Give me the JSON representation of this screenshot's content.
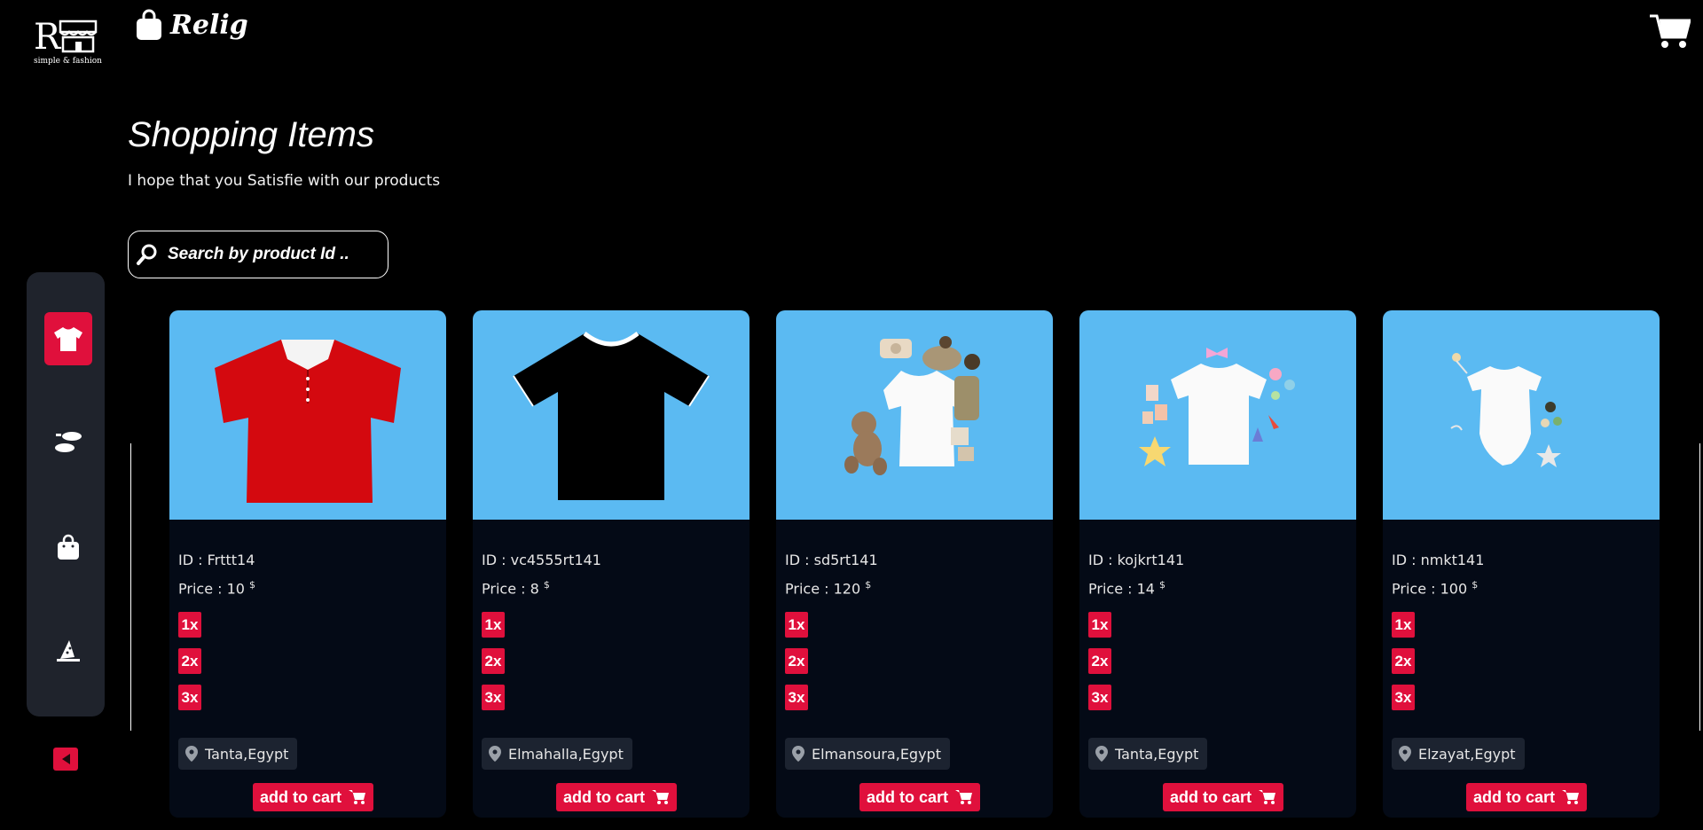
{
  "logo": {
    "mark": "R",
    "tagline": "simple & fashion"
  },
  "brand": {
    "name": "Relig",
    "icon": "shopping-bag-icon"
  },
  "header": {
    "cart_icon": "cart-icon"
  },
  "page": {
    "title": "Shopping Items",
    "subtitle": "I hope that you Satisfie with our products"
  },
  "search": {
    "placeholder": "Search by product Id ..",
    "icon": "search-icon"
  },
  "sidebar": {
    "items": [
      {
        "icon": "tshirt-icon",
        "active": true
      },
      {
        "icon": "shoes-icon",
        "active": false
      },
      {
        "icon": "bag-icon",
        "active": false
      },
      {
        "icon": "hat-icon",
        "active": false
      }
    ],
    "collapse_icon": "caret-left-icon"
  },
  "colors": {
    "accent": "#e0103c",
    "card_image_bg": "#5bbaf2",
    "card_bg": "#040a16",
    "sidebar_bg": "#1f232c"
  },
  "products": [
    {
      "id_text": "ID : Frttt14",
      "price_text": "Price : 10",
      "currency": "$",
      "image": "red-polo-shirt",
      "quantities": [
        "1x",
        "2x",
        "3x"
      ],
      "location": "Tanta,Egypt",
      "add_label": "add to cart"
    },
    {
      "id_text": "ID : vc4555rt141",
      "price_text": "Price : 8",
      "currency": "$",
      "image": "black-tshirt",
      "quantities": [
        "1x",
        "2x",
        "3x"
      ],
      "location": "Elmahalla,Egypt",
      "add_label": "add to cart"
    },
    {
      "id_text": "ID : sd5rt141",
      "price_text": "Price : 120",
      "currency": "$",
      "image": "baby-clothes-teddy-bear",
      "quantities": [
        "1x",
        "2x",
        "3x"
      ],
      "location": "Elmansoura,Egypt",
      "add_label": "add to cart"
    },
    {
      "id_text": "ID : kojkrt141",
      "price_text": "Price : 14",
      "currency": "$",
      "image": "baby-tshirt-set",
      "quantities": [
        "1x",
        "2x",
        "3x"
      ],
      "location": "Tanta,Egypt",
      "add_label": "add to cart"
    },
    {
      "id_text": "ID : nmkt141",
      "price_text": "Price : 100",
      "currency": "$",
      "image": "baby-onesie",
      "quantities": [
        "1x",
        "2x",
        "3x"
      ],
      "location": "Elzayat,Egypt",
      "add_label": "add to cart"
    }
  ]
}
